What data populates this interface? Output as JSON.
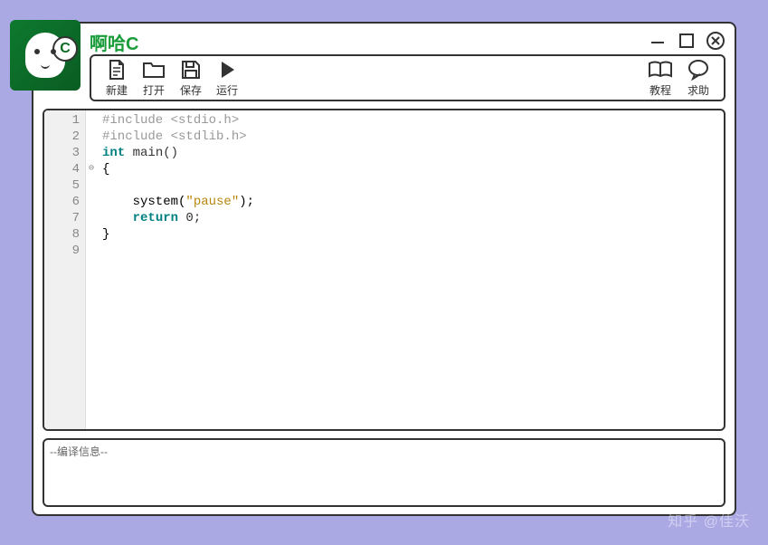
{
  "app": {
    "title": "啊哈C",
    "logo_letter": "C"
  },
  "toolbar": {
    "new_label": "新建",
    "open_label": "打开",
    "save_label": "保存",
    "run_label": "运行",
    "tutorial_label": "教程",
    "help_label": "求助"
  },
  "editor": {
    "lines": [
      {
        "n": "1",
        "tokens": [
          {
            "t": "#include <stdio.h>",
            "cls": "c-pp"
          }
        ]
      },
      {
        "n": "2",
        "tokens": [
          {
            "t": "#include <stdlib.h>",
            "cls": "c-pp"
          }
        ]
      },
      {
        "n": "3",
        "tokens": [
          {
            "t": "int",
            "cls": "c-kw"
          },
          {
            "t": " main()",
            "cls": "c-fn"
          }
        ]
      },
      {
        "n": "4",
        "fold": "⊖",
        "tokens": [
          {
            "t": "{",
            "cls": ""
          }
        ]
      },
      {
        "n": "5",
        "tokens": []
      },
      {
        "n": "6",
        "tokens": [
          {
            "t": "    system(",
            "cls": ""
          },
          {
            "t": "\"pause\"",
            "cls": "c-str"
          },
          {
            "t": ");",
            "cls": ""
          }
        ]
      },
      {
        "n": "7",
        "tokens": [
          {
            "t": "    ",
            "cls": ""
          },
          {
            "t": "return",
            "cls": "c-kw"
          },
          {
            "t": " 0;",
            "cls": "c-num"
          }
        ]
      },
      {
        "n": "8",
        "tokens": [
          {
            "t": "}",
            "cls": ""
          }
        ]
      },
      {
        "n": "9",
        "tokens": []
      }
    ]
  },
  "output": {
    "header": "--编译信息--"
  },
  "watermark": "知乎 @佳沃"
}
